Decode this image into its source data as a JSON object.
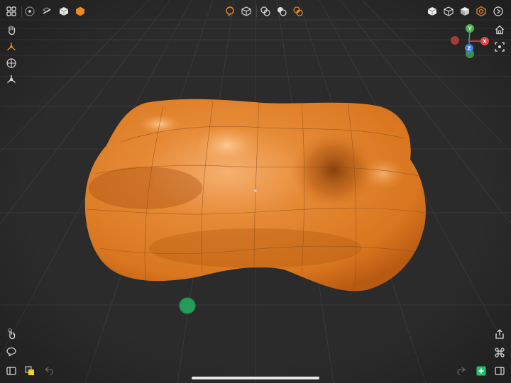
{
  "app": {
    "theme": {
      "background": "#2b2b2b",
      "accent": "#f08a1c",
      "model": "#e07a22",
      "grid": "#3c3c3c"
    }
  },
  "top_toolbar": {
    "left": [
      "apps-grid-icon",
      "snap-icon",
      "slice-icon",
      "solid-cube-icon",
      "hexagon-icon"
    ],
    "center": [
      "lasso-select-icon",
      "wire-cube-icon",
      "boolean-union-icon",
      "boolean-subtract-icon",
      "boolean-intersect-icon"
    ],
    "right": [
      "view-cube-front-icon",
      "view-cube-iso-icon",
      "view-cube-shaded-icon",
      "render-mode-icon",
      "settings-icon"
    ]
  },
  "left_toolbar": [
    "hand-pan-icon",
    "transform-gizmo-icon",
    "snap-target-icon",
    "pivot-icon"
  ],
  "bottom_left": [
    "hand-touch-icon",
    "lasso-icon",
    "sidebar-icon",
    "color-layers-icon",
    "undo-icon"
  ],
  "bottom_right": [
    "share-icon",
    "command-icon",
    "redo-icon",
    "add-object-icon",
    "inspector-icon"
  ],
  "nav_gizmo": {
    "axes": [
      {
        "label": "Y",
        "color": "#4caf50"
      },
      {
        "label": "X",
        "color": "#e04545"
      },
      {
        "label": "Z",
        "color": "#3b7fe0"
      }
    ]
  },
  "right_nav": [
    "home-view-icon",
    "frame-selection-icon"
  ],
  "model": {
    "name": "orange-sculpt-mesh",
    "color": "#e07a22"
  },
  "touch_indicator": {
    "color": "#27c06a"
  }
}
